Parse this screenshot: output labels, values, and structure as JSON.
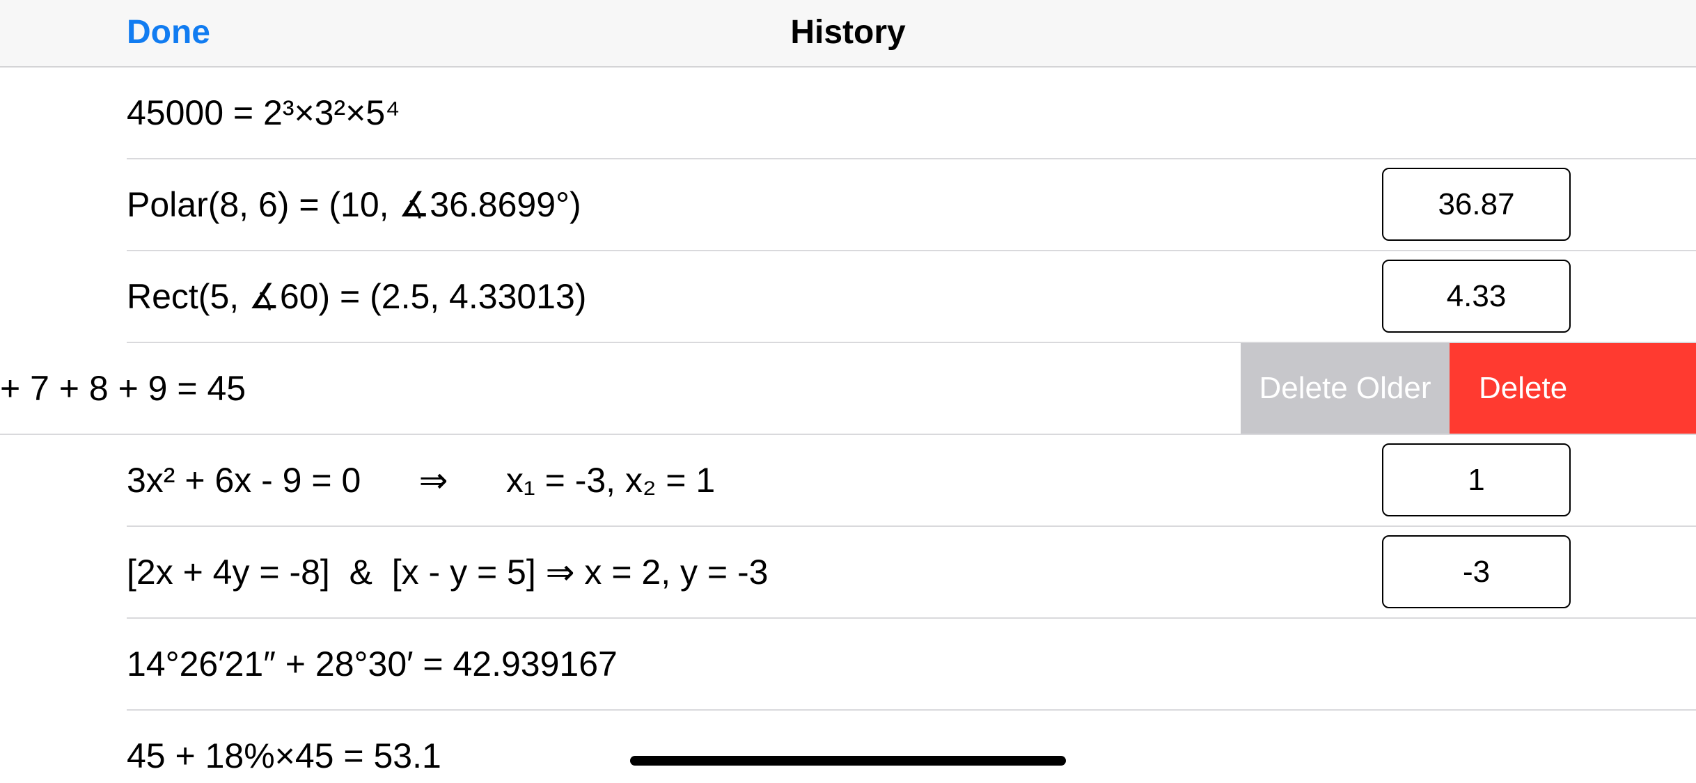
{
  "navbar": {
    "done_label": "Done",
    "title": "History"
  },
  "history": {
    "items": [
      {
        "expression": "45000 = 2³×3²×5⁴",
        "result": ""
      },
      {
        "expression": "Polar(8, 6) = (10, ∡36.8699°)",
        "result": "36.87"
      },
      {
        "expression": "Rect(5, ∡60) = (2.5, 4.33013)",
        "result": "4.33"
      },
      {
        "expression": "+ 7 + 8 + 9 = 45",
        "result": ""
      },
      {
        "expression": "3x² + 6x - 9 = 0      ⇒      x₁ = -3, x₂ = 1",
        "result": "1"
      },
      {
        "expression": "[2x + 4y = -8]  &  [x - y = 5] ⇒ x = 2, y = -3",
        "result": "-3"
      },
      {
        "expression": "14°26′21″ + 28°30′ = 42.939167",
        "result": ""
      },
      {
        "expression": "45 + 18%×45 = 53.1",
        "result": ""
      }
    ],
    "swipe_actions": {
      "delete_older_label": "Delete Older",
      "delete_label": "Delete"
    }
  },
  "colors": {
    "accent": "#117cf1",
    "delete": "#ff3a30",
    "delete_older": "#c7c7cb",
    "navbar_bg": "#f7f7f7",
    "separator": "#d9d9dc"
  }
}
